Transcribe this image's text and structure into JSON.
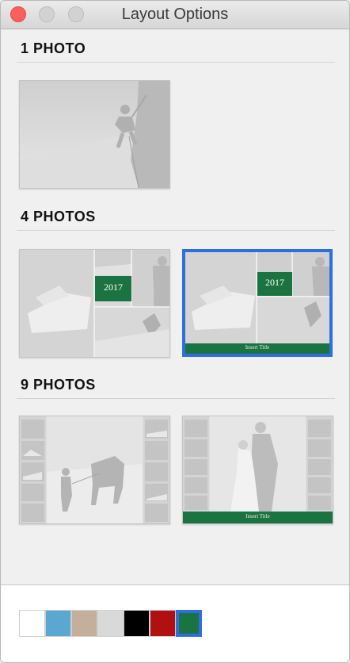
{
  "window": {
    "title": "Layout Options",
    "traffic_lights": [
      "close-button",
      "minimize-button",
      "zoom-button"
    ]
  },
  "sections": [
    {
      "title": "1 PHOTO"
    },
    {
      "title": "4 PHOTOS"
    },
    {
      "title": "9 PHOTOS"
    }
  ],
  "layouts": {
    "four_a_year": "2017",
    "four_b_year": "2017",
    "four_b_caption": "Insert Title",
    "nine_b_caption": "Insert Title"
  },
  "selected_layout": "4 photos, layout 2",
  "colors": {
    "accent": "#2e6fe0",
    "theme_green": "#1a7340"
  },
  "swatches": [
    {
      "name": "white",
      "color": "#ffffff",
      "selected": false
    },
    {
      "name": "blue",
      "color": "#5aa8d2",
      "selected": false
    },
    {
      "name": "tan",
      "color": "#c4b09a",
      "selected": false
    },
    {
      "name": "light-gray",
      "color": "#d9d9d9",
      "selected": false
    },
    {
      "name": "black",
      "color": "#000000",
      "selected": false
    },
    {
      "name": "red",
      "color": "#b01010",
      "selected": false
    },
    {
      "name": "green",
      "color": "#1a7340",
      "selected": true
    }
  ]
}
